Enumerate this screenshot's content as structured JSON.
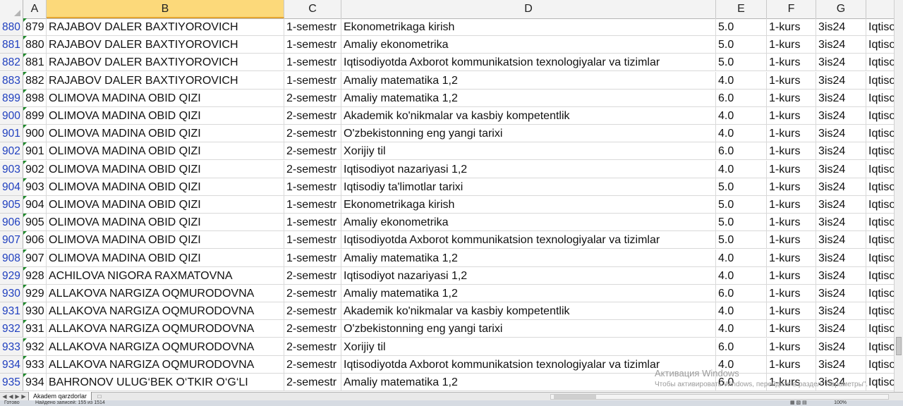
{
  "columns": [
    {
      "id": "A",
      "label": "A"
    },
    {
      "id": "B",
      "label": "B"
    },
    {
      "id": "C",
      "label": "C"
    },
    {
      "id": "D",
      "label": "D"
    },
    {
      "id": "E",
      "label": "E"
    },
    {
      "id": "F",
      "label": "F"
    },
    {
      "id": "G",
      "label": "G"
    },
    {
      "id": "H",
      "label": ""
    }
  ],
  "rows": [
    {
      "rownum": "880",
      "a": "879",
      "b": "RAJABOV DALER BAXTIYOROVICH",
      "c": "1-semestr",
      "d": "Ekonometrikaga kirish",
      "e": "5.0",
      "f": "1-kurs",
      "g": "3is24",
      "h": "Iqtiso"
    },
    {
      "rownum": "881",
      "a": "880",
      "b": "RAJABOV DALER BAXTIYOROVICH",
      "c": "1-semestr",
      "d": "Amaliy ekonometrika",
      "e": "5.0",
      "f": "1-kurs",
      "g": "3is24",
      "h": "Iqtiso"
    },
    {
      "rownum": "882",
      "a": "881",
      "b": "RAJABOV DALER BAXTIYOROVICH",
      "c": "1-semestr",
      "d": "Iqtisodiyotda Axborot kommunikatsion texnologiyalar va tizimlar",
      "e": "5.0",
      "f": "1-kurs",
      "g": "3is24",
      "h": "Iqtiso"
    },
    {
      "rownum": "883",
      "a": "882",
      "b": "RAJABOV DALER BAXTIYOROVICH",
      "c": "1-semestr",
      "d": "Amaliy matematika 1,2",
      "e": "4.0",
      "f": "1-kurs",
      "g": "3is24",
      "h": "Iqtiso"
    },
    {
      "rownum": "899",
      "a": "898",
      "b": "OLIMOVA MADINA OBID QIZI",
      "c": "2-semestr",
      "d": "Amaliy matematika 1,2",
      "e": "6.0",
      "f": "1-kurs",
      "g": "3is24",
      "h": "Iqtiso"
    },
    {
      "rownum": "900",
      "a": "899",
      "b": "OLIMOVA MADINA OBID QIZI",
      "c": "2-semestr",
      "d": "Akademik ko'nikmalar va kasbiy kompetentlik",
      "e": "4.0",
      "f": "1-kurs",
      "g": "3is24",
      "h": "Iqtiso"
    },
    {
      "rownum": "901",
      "a": "900",
      "b": "OLIMOVA MADINA OBID QIZI",
      "c": "2-semestr",
      "d": "O'zbekistonning eng yangi tarixi",
      "e": "4.0",
      "f": "1-kurs",
      "g": "3is24",
      "h": "Iqtiso"
    },
    {
      "rownum": "902",
      "a": "901",
      "b": "OLIMOVA MADINA OBID QIZI",
      "c": "2-semestr",
      "d": "Xorijiy til",
      "e": "6.0",
      "f": "1-kurs",
      "g": "3is24",
      "h": "Iqtiso"
    },
    {
      "rownum": "903",
      "a": "902",
      "b": "OLIMOVA MADINA OBID QIZI",
      "c": "2-semestr",
      "d": "Iqtisodiyot nazariyasi 1,2",
      "e": "4.0",
      "f": "1-kurs",
      "g": "3is24",
      "h": "Iqtiso"
    },
    {
      "rownum": "904",
      "a": "903",
      "b": "OLIMOVA MADINA OBID QIZI",
      "c": "1-semestr",
      "d": "Iqtisodiy ta'limotlar tarixi",
      "e": "5.0",
      "f": "1-kurs",
      "g": "3is24",
      "h": "Iqtiso"
    },
    {
      "rownum": "905",
      "a": "904",
      "b": "OLIMOVA MADINA OBID QIZI",
      "c": "1-semestr",
      "d": "Ekonometrikaga kirish",
      "e": "5.0",
      "f": "1-kurs",
      "g": "3is24",
      "h": "Iqtiso"
    },
    {
      "rownum": "906",
      "a": "905",
      "b": "OLIMOVA MADINA OBID QIZI",
      "c": "1-semestr",
      "d": "Amaliy ekonometrika",
      "e": "5.0",
      "f": "1-kurs",
      "g": "3is24",
      "h": "Iqtiso"
    },
    {
      "rownum": "907",
      "a": "906",
      "b": "OLIMOVA MADINA OBID QIZI",
      "c": "1-semestr",
      "d": "Iqtisodiyotda Axborot kommunikatsion texnologiyalar va tizimlar",
      "e": "5.0",
      "f": "1-kurs",
      "g": "3is24",
      "h": "Iqtiso"
    },
    {
      "rownum": "908",
      "a": "907",
      "b": "OLIMOVA MADINA OBID QIZI",
      "c": "1-semestr",
      "d": "Amaliy matematika 1,2",
      "e": "4.0",
      "f": "1-kurs",
      "g": "3is24",
      "h": "Iqtiso"
    },
    {
      "rownum": "929",
      "a": "928",
      "b": "ACHILOVA NIGORA RAXMATOVNA",
      "c": "2-semestr",
      "d": "Iqtisodiyot nazariyasi 1,2",
      "e": "4.0",
      "f": "1-kurs",
      "g": "3is24",
      "h": "Iqtiso"
    },
    {
      "rownum": "930",
      "a": "929",
      "b": "ALLAKOVA NARGIZA OQMURODOVNA",
      "c": "2-semestr",
      "d": "Amaliy matematika 1,2",
      "e": "6.0",
      "f": "1-kurs",
      "g": "3is24",
      "h": "Iqtiso"
    },
    {
      "rownum": "931",
      "a": "930",
      "b": "ALLAKOVA NARGIZA OQMURODOVNA",
      "c": "2-semestr",
      "d": "Akademik ko'nikmalar va kasbiy kompetentlik",
      "e": "4.0",
      "f": "1-kurs",
      "g": "3is24",
      "h": "Iqtiso"
    },
    {
      "rownum": "932",
      "a": "931",
      "b": "ALLAKOVA NARGIZA OQMURODOVNA",
      "c": "2-semestr",
      "d": "O'zbekistonning eng yangi tarixi",
      "e": "4.0",
      "f": "1-kurs",
      "g": "3is24",
      "h": "Iqtiso"
    },
    {
      "rownum": "933",
      "a": "932",
      "b": "ALLAKOVA NARGIZA OQMURODOVNA",
      "c": "2-semestr",
      "d": "Xorijiy til",
      "e": "6.0",
      "f": "1-kurs",
      "g": "3is24",
      "h": "Iqtiso"
    },
    {
      "rownum": "934",
      "a": "933",
      "b": "ALLAKOVA NARGIZA OQMURODOVNA",
      "c": "2-semestr",
      "d": "Iqtisodiyotda Axborot kommunikatsion texnologiyalar va tizimlar",
      "e": "4.0",
      "f": "1-kurs",
      "g": "3is24",
      "h": "Iqtiso"
    },
    {
      "rownum": "935",
      "a": "934",
      "b": "BAHRONOV ULUG‘BEK O‘TKIR O‘G‘LI",
      "c": "2-semestr",
      "d": "Amaliy matematika 1,2",
      "e": "6.0",
      "f": "1-kurs",
      "g": "3is24",
      "h": "Iqtiso"
    }
  ],
  "sheet_tab": {
    "label": "Akadem qarzdorlar"
  },
  "watermark": {
    "line1": "Активация Windows",
    "line2": "Чтобы активировать Windows, перейдите в раздел \"Параметры\"."
  },
  "status": {
    "ready": "Готово",
    "message": "Найдено записей: 155 из 1514",
    "zoom": "100%"
  },
  "colors": {
    "selected_header": "#fcd97a",
    "row_number": "#1f3fbf",
    "green_marker": "#1e8a2a"
  }
}
